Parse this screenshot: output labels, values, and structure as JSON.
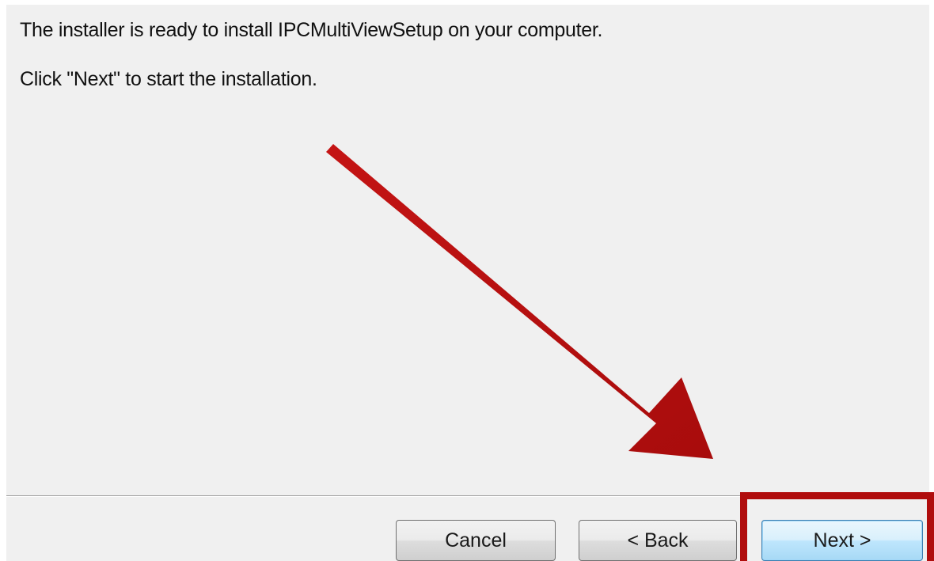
{
  "dialog": {
    "message_line1": "The installer is ready to install IPCMultiViewSetup on your computer.",
    "message_line2": "Click \"Next\" to start the installation."
  },
  "buttons": {
    "cancel_label": "Cancel",
    "back_label": "< Back",
    "next_label": "Next >"
  },
  "annotation": {
    "arrow_icon": "red-arrow-icon",
    "highlight_color": "#b00d0d",
    "arrow_color": "#b30f0f"
  }
}
